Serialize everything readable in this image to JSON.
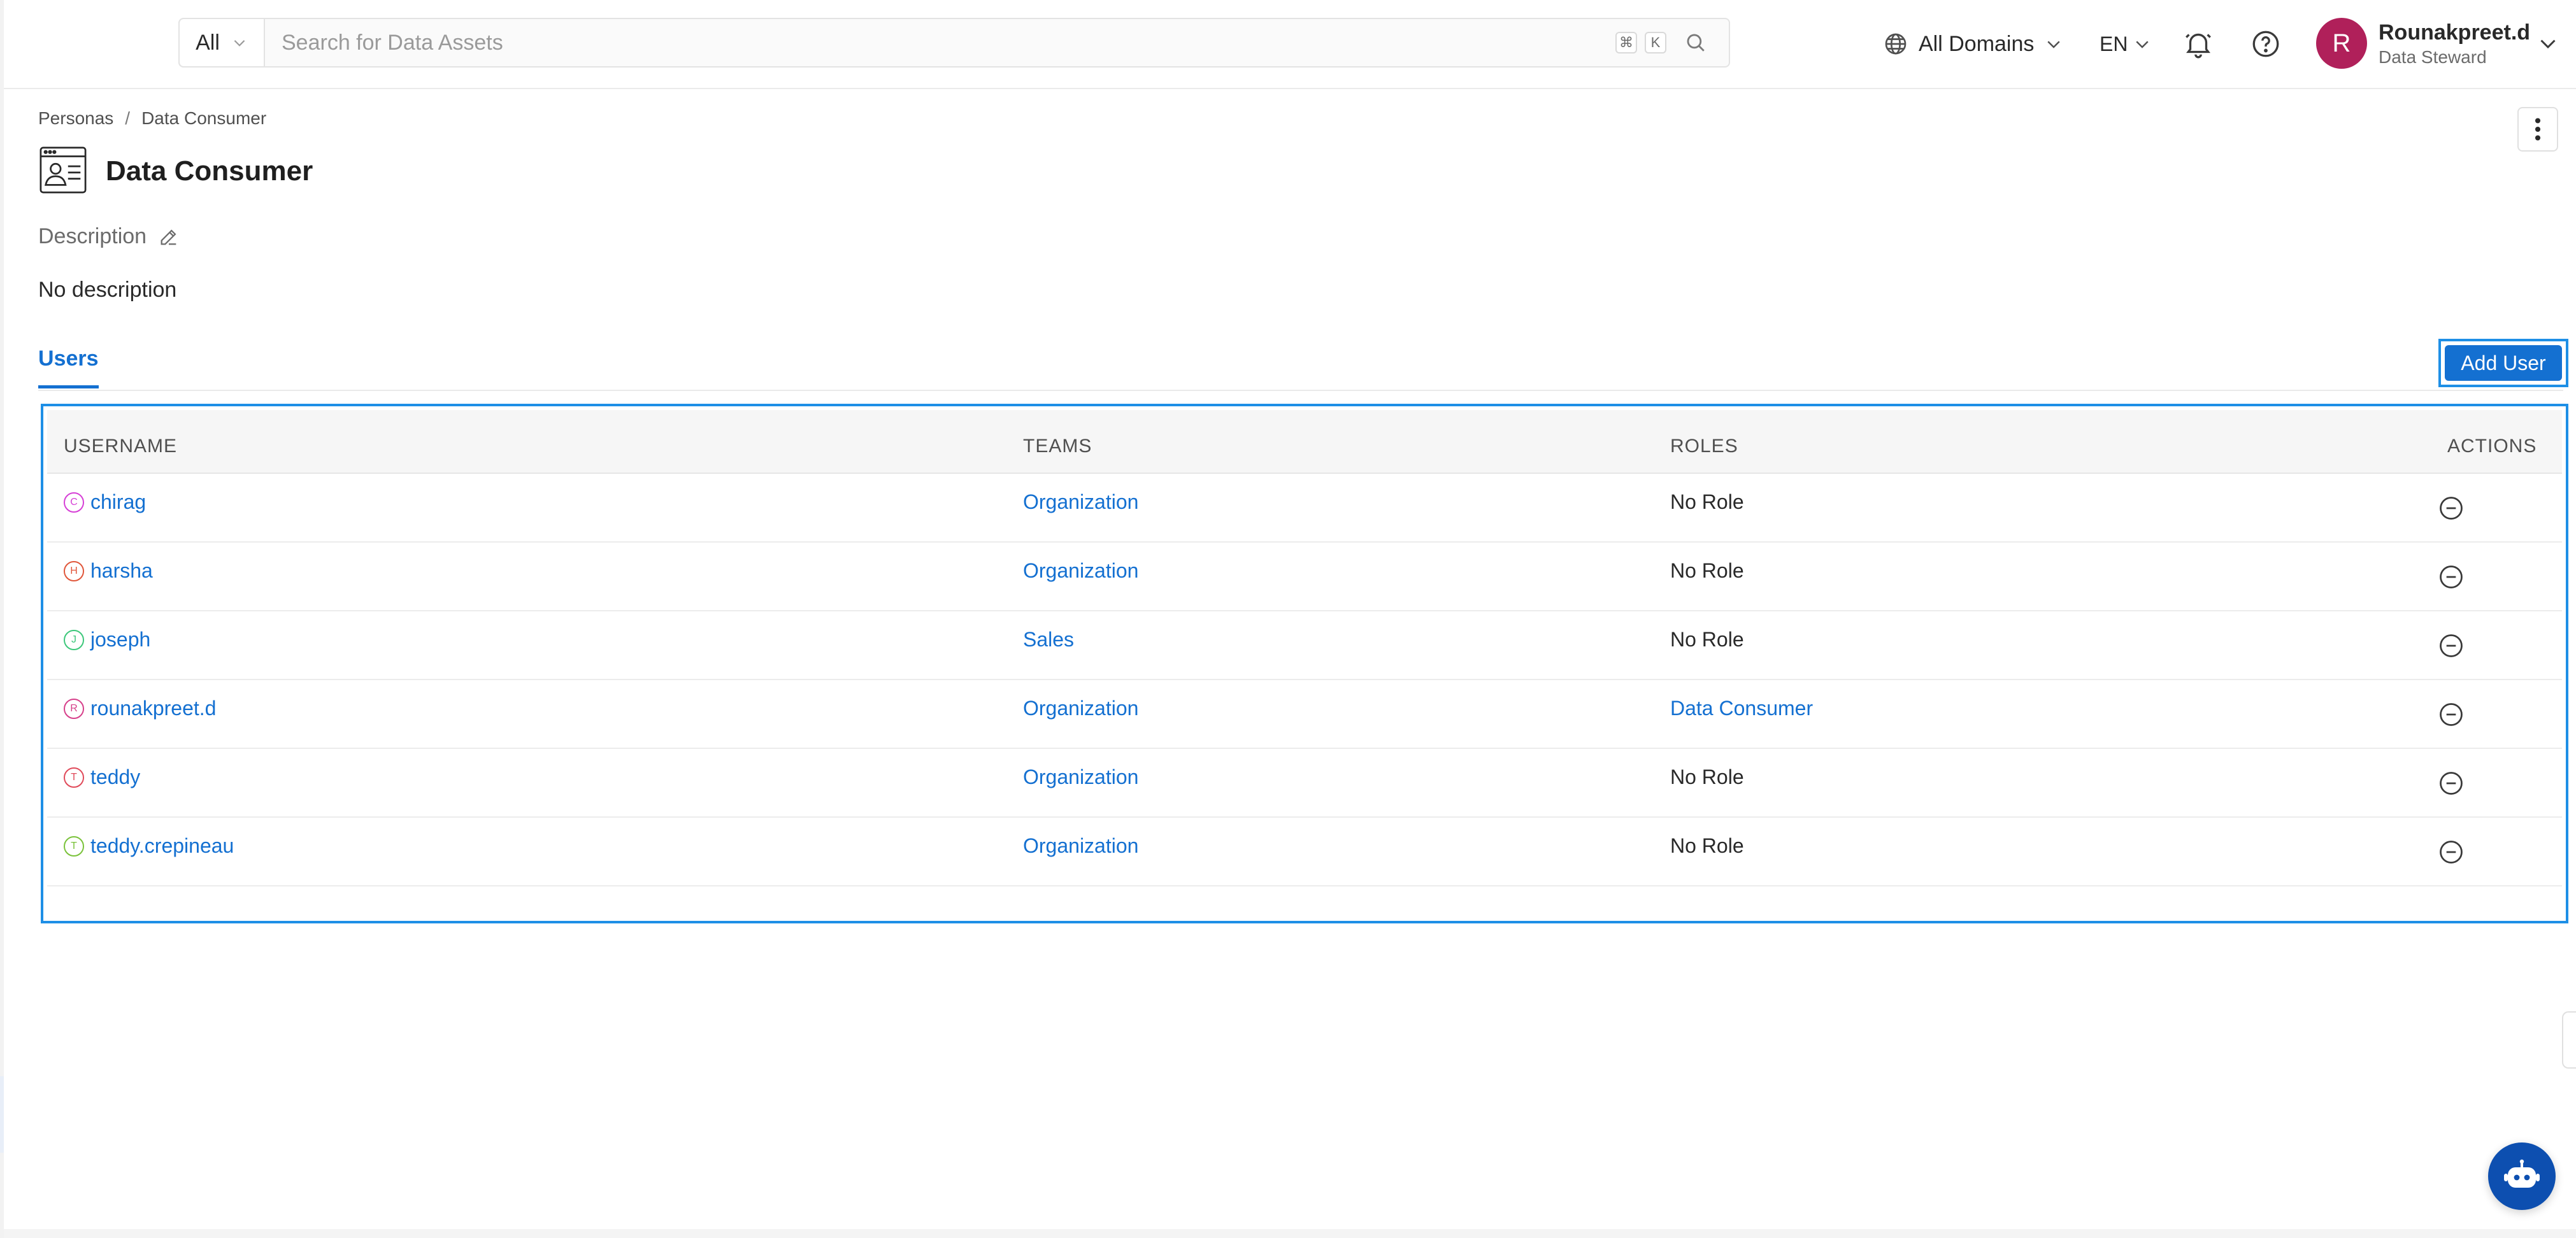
{
  "header": {
    "search_scope": "All",
    "search_placeholder": "Search for Data Assets",
    "shortcut_keys": [
      "⌘",
      "K"
    ],
    "domain_selector": "All Domains",
    "language": "EN",
    "user": {
      "initial": "R",
      "name": "Rounakpreet.d",
      "role": "Data Steward",
      "avatar_color": "#b0205a"
    }
  },
  "breadcrumb": [
    "Personas",
    "Data Consumer"
  ],
  "breadcrumb_separator": "/",
  "page": {
    "title": "Data Consumer",
    "description_label": "Description",
    "description_text": "No description"
  },
  "tabs": [
    {
      "label": "Users",
      "active": true
    }
  ],
  "actions": {
    "add_user": "Add User"
  },
  "table": {
    "columns": [
      "USERNAME",
      "TEAMS",
      "ROLES",
      "ACTIONS"
    ],
    "rows": [
      {
        "initial": "C",
        "avatar_color": "#d63fd6",
        "username": "chirag",
        "team": "Organization",
        "role": "No Role",
        "role_is_link": false
      },
      {
        "initial": "H",
        "avatar_color": "#e0563a",
        "username": "harsha",
        "team": "Organization",
        "role": "No Role",
        "role_is_link": false
      },
      {
        "initial": "J",
        "avatar_color": "#3cc77a",
        "username": "joseph",
        "team": "Sales",
        "role": "No Role",
        "role_is_link": false
      },
      {
        "initial": "R",
        "avatar_color": "#d63f8a",
        "username": "rounakpreet.d",
        "team": "Organization",
        "role": "Data Consumer",
        "role_is_link": true
      },
      {
        "initial": "T",
        "avatar_color": "#e04a5a",
        "username": "teddy",
        "team": "Organization",
        "role": "No Role",
        "role_is_link": false
      },
      {
        "initial": "T",
        "avatar_color": "#7ac23a",
        "username": "teddy.crepineau",
        "team": "Organization",
        "role": "No Role",
        "role_is_link": false
      }
    ]
  },
  "colors": {
    "accent": "#1470d1",
    "highlight_border": "#1e8fe6",
    "bot_button": "#0d4fb0"
  },
  "icons": {
    "search": "search-icon",
    "globe": "globe-icon",
    "bell": "bell-icon",
    "help": "help-icon",
    "more": "kebab-menu-icon",
    "edit": "pencil-icon",
    "remove": "minus-circle-icon",
    "bot": "chatbot-icon"
  }
}
